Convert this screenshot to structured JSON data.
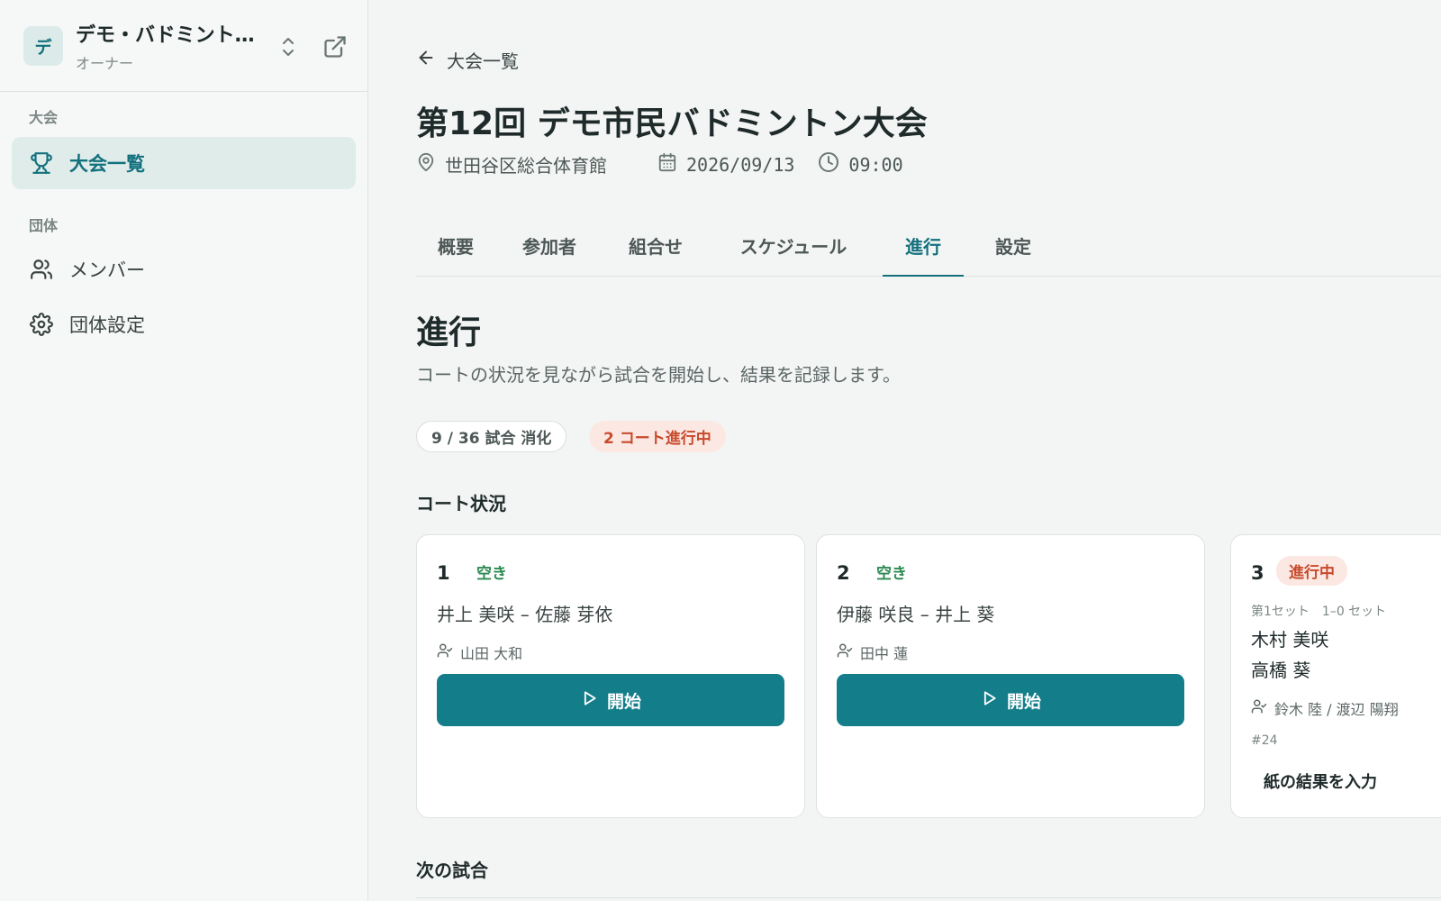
{
  "sidebar": {
    "org": {
      "avatar": "デ",
      "name": "デモ・バドミントン…",
      "role": "オーナー"
    },
    "sections": [
      {
        "label": "大会",
        "items": [
          {
            "label": "大会一覧",
            "icon": "trophy-icon",
            "active": true
          }
        ]
      },
      {
        "label": "団体",
        "items": [
          {
            "label": "メンバー",
            "icon": "users-icon"
          },
          {
            "label": "団体設定",
            "icon": "gear-icon"
          }
        ]
      }
    ]
  },
  "header": {
    "back_label": "大会一覧",
    "title": "第12回 デモ市民バドミントン大会",
    "venue": "世田谷区総合体育館",
    "date": "2026/09/13",
    "time": "09:00"
  },
  "tabs": [
    "概要",
    "参加者",
    "組合せ",
    "スケジュール",
    "進行",
    "設定"
  ],
  "active_tab": "進行",
  "progress": {
    "heading": "進行",
    "description": "コートの状況を見ながら試合を開始し、結果を記録します。",
    "matches_badge": "9 / 36 試合 消化",
    "courts_badge": "2 コート進行中",
    "court_heading": "コート状況",
    "courts": [
      {
        "number": "1",
        "status": "空き",
        "players": "井上 美咲 – 佐藤 芽依",
        "umpire": "山田 大和",
        "action": "開始"
      },
      {
        "number": "2",
        "status": "空き",
        "players": "伊藤 咲良 – 井上 葵",
        "umpire": "田中 蓮",
        "action": "開始"
      },
      {
        "number": "3",
        "status": "進行中",
        "set_info": "第1セット　1–0 セット",
        "player1": "木村 美咲",
        "player2": "高橋 葵",
        "umpires": "鈴木 陸 / 渡辺 陽翔",
        "match_no": "#24",
        "action": "紙の結果を入力"
      }
    ],
    "next_heading": "次の試合"
  },
  "colors": {
    "accent": "#137d8a",
    "active_bg": "#dfecea",
    "free": "#2e8a53",
    "busy": "#c74a2b",
    "busy_bg": "#fbe8e3"
  }
}
